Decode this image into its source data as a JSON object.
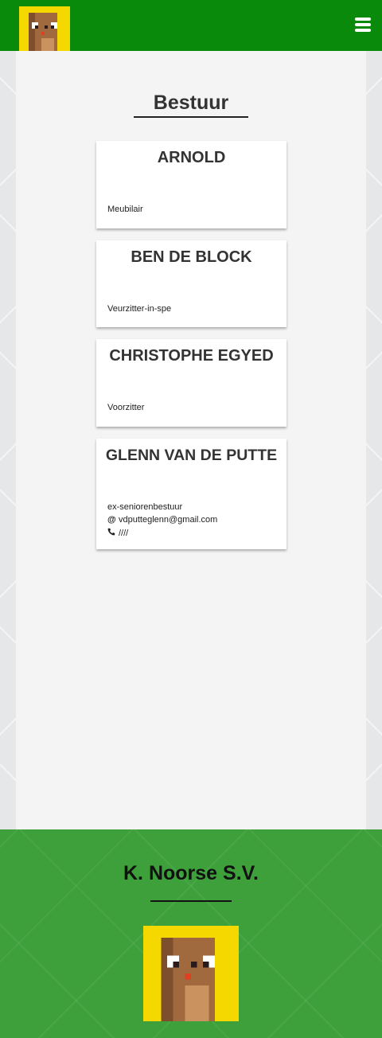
{
  "header": {
    "logo_icon": "beaver-pixel-logo-icon",
    "menu_icon": "hamburger-menu-icon"
  },
  "colors": {
    "header_green": "#0a8a0a",
    "footer_green": "#3ea03a",
    "page_bg": "#f4f4f4"
  },
  "page": {
    "title": "Bestuur"
  },
  "members": [
    {
      "name": "ARNOLD",
      "role": "Meubilair"
    },
    {
      "name": "BEN DE BLOCK",
      "role": "Veurzitter-in-spe"
    },
    {
      "name": "CHRISTOPHE EGYED",
      "role": "Voorzitter"
    },
    {
      "name": "GLENN VAN DE PUTTE",
      "role": "ex-seniorenbestuur",
      "email_icon": "@",
      "email": "vdputteglenn@gmail.com",
      "phone_icon": "phone-icon",
      "phone": "////"
    }
  ],
  "footer": {
    "title": "K. Noorse S.V.",
    "logo_icon": "beaver-pixel-logo-icon"
  }
}
